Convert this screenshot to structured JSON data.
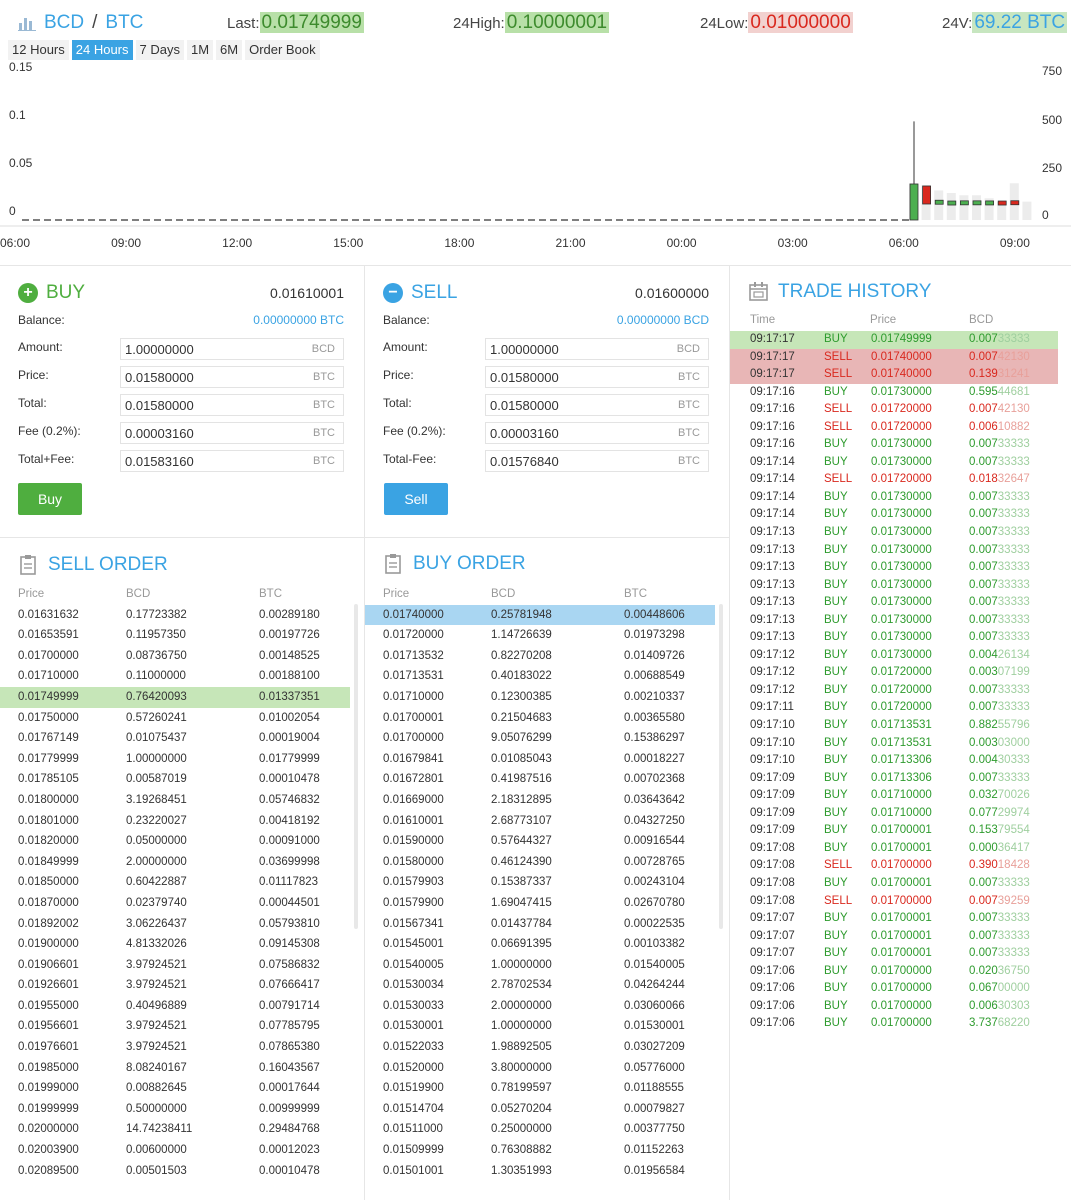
{
  "header": {
    "base": "BCD",
    "sep": "/",
    "quote": "BTC",
    "last_label": "Last:",
    "last_value": "0.01749999",
    "high_label": "24High:",
    "high_value": "0.10000001",
    "low_label": "24Low:",
    "low_value": "0.01000000",
    "vol_label": "24V:",
    "vol_value": "69.22 BTC"
  },
  "tabs": [
    {
      "label": "12 Hours",
      "active": false
    },
    {
      "label": "24 Hours",
      "active": true
    },
    {
      "label": "7 Days",
      "active": false
    },
    {
      "label": "1M",
      "active": false
    },
    {
      "label": "6M",
      "active": false
    },
    {
      "label": "Order Book",
      "active": false
    }
  ],
  "chart_data": {
    "type": "candlestick",
    "title": "",
    "y_left_ticks": [
      "0.15",
      "0.1",
      "0.05",
      "0"
    ],
    "y_left_range": [
      0,
      0.15
    ],
    "y_right_ticks": [
      "750",
      "500",
      "250",
      "0"
    ],
    "y_right_range": [
      0,
      750
    ],
    "x_ticks": [
      "06:00",
      "09:00",
      "12:00",
      "15:00",
      "18:00",
      "21:00",
      "00:00",
      "03:00",
      "06:00",
      "09:00"
    ],
    "candles": [
      {
        "open": 0.0175,
        "close": 0.0175,
        "high": 0.1,
        "low": 0.012,
        "bull": true
      },
      {
        "open": 0.0175,
        "close": 0.0175,
        "high": 0.0175,
        "low": 0.0175,
        "bull": true
      },
      {
        "open": 0.018,
        "close": 0.0175,
        "high": 0.018,
        "low": 0.0175,
        "bull": true
      },
      {
        "open": 0.0172,
        "close": 0.0172,
        "high": 0.0172,
        "low": 0.0172,
        "bull": true
      },
      {
        "open": 0.0174,
        "close": 0.0174,
        "high": 0.0174,
        "low": 0.0174,
        "bull": true
      },
      {
        "open": 0.0174,
        "close": 0.0174,
        "high": 0.0174,
        "low": 0.0174,
        "bull": true
      },
      {
        "open": 0.0173,
        "close": 0.0173,
        "high": 0.0173,
        "low": 0.0173,
        "bull": true
      },
      {
        "open": 0.0172,
        "close": 0.0172,
        "high": 0.0172,
        "low": 0.0172,
        "bull": false
      },
      {
        "open": 0.0175,
        "close": 0.0174,
        "high": 0.0176,
        "low": 0.0173,
        "bull": false
      }
    ],
    "volumes": [
      490,
      465,
      395,
      360,
      330,
      330,
      290,
      240,
      490,
      245
    ]
  },
  "buy_panel": {
    "title": "BUY",
    "price_top": "0.01610001",
    "balance_label": "Balance:",
    "balance_value": "0.00000000 BTC",
    "amount_label": "Amount:",
    "amount_value": "1.00000000",
    "amount_unit": "BCD",
    "price_label": "Price:",
    "price_value": "0.01580000",
    "price_unit": "BTC",
    "total_label": "Total:",
    "total_value": "0.01580000",
    "total_unit": "BTC",
    "fee_label": "Fee (0.2%):",
    "fee_value": "0.00003160",
    "fee_unit": "BTC",
    "tf_label": "Total+Fee:",
    "tf_value": "0.01583160",
    "tf_unit": "BTC",
    "button": "Buy"
  },
  "sell_panel": {
    "title": "SELL",
    "price_top": "0.01600000",
    "balance_label": "Balance:",
    "balance_value": "0.00000000 BCD",
    "amount_label": "Amount:",
    "amount_value": "1.00000000",
    "amount_unit": "BCD",
    "price_label": "Price:",
    "price_value": "0.01580000",
    "price_unit": "BTC",
    "total_label": "Total:",
    "total_value": "0.01580000",
    "total_unit": "BTC",
    "fee_label": "Fee (0.2%):",
    "fee_value": "0.00003160",
    "fee_unit": "BTC",
    "tf_label": "Total-Fee:",
    "tf_value": "0.01576840",
    "tf_unit": "BTC",
    "button": "Sell"
  },
  "sell_order": {
    "title": "SELL ORDER",
    "headers": [
      "Price",
      "BCD",
      "BTC"
    ],
    "highlight_index": 4,
    "rows": [
      [
        "0.01631632",
        "0.17723382",
        "0.00289180"
      ],
      [
        "0.01653591",
        "0.11957350",
        "0.00197726"
      ],
      [
        "0.01700000",
        "0.08736750",
        "0.00148525"
      ],
      [
        "0.01710000",
        "0.11000000",
        "0.00188100"
      ],
      [
        "0.01749999",
        "0.76420093",
        "0.01337351"
      ],
      [
        "0.01750000",
        "0.57260241",
        "0.01002054"
      ],
      [
        "0.01767149",
        "0.01075437",
        "0.00019004"
      ],
      [
        "0.01779999",
        "1.00000000",
        "0.01779999"
      ],
      [
        "0.01785105",
        "0.00587019",
        "0.00010478"
      ],
      [
        "0.01800000",
        "3.19268451",
        "0.05746832"
      ],
      [
        "0.01801000",
        "0.23220027",
        "0.00418192"
      ],
      [
        "0.01820000",
        "0.05000000",
        "0.00091000"
      ],
      [
        "0.01849999",
        "2.00000000",
        "0.03699998"
      ],
      [
        "0.01850000",
        "0.60422887",
        "0.01117823"
      ],
      [
        "0.01870000",
        "0.02379740",
        "0.00044501"
      ],
      [
        "0.01892002",
        "3.06226437",
        "0.05793810"
      ],
      [
        "0.01900000",
        "4.81332026",
        "0.09145308"
      ],
      [
        "0.01906601",
        "3.97924521",
        "0.07586832"
      ],
      [
        "0.01926601",
        "3.97924521",
        "0.07666417"
      ],
      [
        "0.01955000",
        "0.40496889",
        "0.00791714"
      ],
      [
        "0.01956601",
        "3.97924521",
        "0.07785795"
      ],
      [
        "0.01976601",
        "3.97924521",
        "0.07865380"
      ],
      [
        "0.01985000",
        "8.08240167",
        "0.16043567"
      ],
      [
        "0.01999000",
        "0.00882645",
        "0.00017644"
      ],
      [
        "0.01999999",
        "0.50000000",
        "0.00999999"
      ],
      [
        "0.02000000",
        "14.74238411",
        "0.29484768"
      ],
      [
        "0.02003900",
        "0.00600000",
        "0.00012023"
      ],
      [
        "0.02089500",
        "0.00501503",
        "0.00010478"
      ]
    ]
  },
  "buy_order": {
    "title": "BUY ORDER",
    "headers": [
      "Price",
      "BCD",
      "BTC"
    ],
    "highlight_index": 0,
    "rows": [
      [
        "0.01740000",
        "0.25781948",
        "0.00448606"
      ],
      [
        "0.01720000",
        "1.14726639",
        "0.01973298"
      ],
      [
        "0.01713532",
        "0.82270208",
        "0.01409726"
      ],
      [
        "0.01713531",
        "0.40183022",
        "0.00688549"
      ],
      [
        "0.01710000",
        "0.12300385",
        "0.00210337"
      ],
      [
        "0.01700001",
        "0.21504683",
        "0.00365580"
      ],
      [
        "0.01700000",
        "9.05076299",
        "0.15386297"
      ],
      [
        "0.01679841",
        "0.01085043",
        "0.00018227"
      ],
      [
        "0.01672801",
        "0.41987516",
        "0.00702368"
      ],
      [
        "0.01669000",
        "2.18312895",
        "0.03643642"
      ],
      [
        "0.01610001",
        "2.68773107",
        "0.04327250"
      ],
      [
        "0.01590000",
        "0.57644327",
        "0.00916544"
      ],
      [
        "0.01580000",
        "0.46124390",
        "0.00728765"
      ],
      [
        "0.01579903",
        "0.15387337",
        "0.00243104"
      ],
      [
        "0.01579900",
        "1.69047415",
        "0.02670780"
      ],
      [
        "0.01567341",
        "0.01437784",
        "0.00022535"
      ],
      [
        "0.01545001",
        "0.06691395",
        "0.00103382"
      ],
      [
        "0.01540005",
        "1.00000000",
        "0.01540005"
      ],
      [
        "0.01530034",
        "2.78702534",
        "0.04264244"
      ],
      [
        "0.01530033",
        "2.00000000",
        "0.03060066"
      ],
      [
        "0.01530001",
        "1.00000000",
        "0.01530001"
      ],
      [
        "0.01522033",
        "1.98892505",
        "0.03027209"
      ],
      [
        "0.01520000",
        "3.80000000",
        "0.05776000"
      ],
      [
        "0.01519900",
        "0.78199597",
        "0.01188555"
      ],
      [
        "0.01514704",
        "0.05270204",
        "0.00079827"
      ],
      [
        "0.01511000",
        "0.25000000",
        "0.00377750"
      ],
      [
        "0.01509999",
        "0.76308882",
        "0.01152263"
      ],
      [
        "0.01501001",
        "1.30351993",
        "0.01956584"
      ]
    ]
  },
  "trade_history": {
    "title": "TRADE HISTORY",
    "headers": [
      "Time",
      "Price",
      "BCD"
    ],
    "rows": [
      {
        "time": "09:17:17",
        "side": "BUY",
        "price": "0.01749999",
        "amt_a": "0.007",
        "amt_b": "33333",
        "hl": "green"
      },
      {
        "time": "09:17:17",
        "side": "SELL",
        "price": "0.01740000",
        "amt_a": "0.007",
        "amt_b": "42130",
        "hl": "red"
      },
      {
        "time": "09:17:17",
        "side": "SELL",
        "price": "0.01740000",
        "amt_a": "0.139",
        "amt_b": "31241",
        "hl": "red"
      },
      {
        "time": "09:17:16",
        "side": "BUY",
        "price": "0.01730000",
        "amt_a": "0.595",
        "amt_b": "44681",
        "hl": ""
      },
      {
        "time": "09:17:16",
        "side": "SELL",
        "price": "0.01720000",
        "amt_a": "0.007",
        "amt_b": "42130",
        "hl": ""
      },
      {
        "time": "09:17:16",
        "side": "SELL",
        "price": "0.01720000",
        "amt_a": "0.006",
        "amt_b": "10882",
        "hl": ""
      },
      {
        "time": "09:17:16",
        "side": "BUY",
        "price": "0.01730000",
        "amt_a": "0.007",
        "amt_b": "33333",
        "hl": ""
      },
      {
        "time": "09:17:14",
        "side": "BUY",
        "price": "0.01730000",
        "amt_a": "0.007",
        "amt_b": "33333",
        "hl": ""
      },
      {
        "time": "09:17:14",
        "side": "SELL",
        "price": "0.01720000",
        "amt_a": "0.018",
        "amt_b": "32647",
        "hl": ""
      },
      {
        "time": "09:17:14",
        "side": "BUY",
        "price": "0.01730000",
        "amt_a": "0.007",
        "amt_b": "33333",
        "hl": ""
      },
      {
        "time": "09:17:14",
        "side": "BUY",
        "price": "0.01730000",
        "amt_a": "0.007",
        "amt_b": "33333",
        "hl": ""
      },
      {
        "time": "09:17:13",
        "side": "BUY",
        "price": "0.01730000",
        "amt_a": "0.007",
        "amt_b": "33333",
        "hl": ""
      },
      {
        "time": "09:17:13",
        "side": "BUY",
        "price": "0.01730000",
        "amt_a": "0.007",
        "amt_b": "33333",
        "hl": ""
      },
      {
        "time": "09:17:13",
        "side": "BUY",
        "price": "0.01730000",
        "amt_a": "0.007",
        "amt_b": "33333",
        "hl": ""
      },
      {
        "time": "09:17:13",
        "side": "BUY",
        "price": "0.01730000",
        "amt_a": "0.007",
        "amt_b": "33333",
        "hl": ""
      },
      {
        "time": "09:17:13",
        "side": "BUY",
        "price": "0.01730000",
        "amt_a": "0.007",
        "amt_b": "33333",
        "hl": ""
      },
      {
        "time": "09:17:13",
        "side": "BUY",
        "price": "0.01730000",
        "amt_a": "0.007",
        "amt_b": "33333",
        "hl": ""
      },
      {
        "time": "09:17:13",
        "side": "BUY",
        "price": "0.01730000",
        "amt_a": "0.007",
        "amt_b": "33333",
        "hl": ""
      },
      {
        "time": "09:17:12",
        "side": "BUY",
        "price": "0.01730000",
        "amt_a": "0.004",
        "amt_b": "26134",
        "hl": ""
      },
      {
        "time": "09:17:12",
        "side": "BUY",
        "price": "0.01720000",
        "amt_a": "0.003",
        "amt_b": "07199",
        "hl": ""
      },
      {
        "time": "09:17:12",
        "side": "BUY",
        "price": "0.01720000",
        "amt_a": "0.007",
        "amt_b": "33333",
        "hl": ""
      },
      {
        "time": "09:17:11",
        "side": "BUY",
        "price": "0.01720000",
        "amt_a": "0.007",
        "amt_b": "33333",
        "hl": ""
      },
      {
        "time": "09:17:10",
        "side": "BUY",
        "price": "0.01713531",
        "amt_a": "0.882",
        "amt_b": "55796",
        "hl": ""
      },
      {
        "time": "09:17:10",
        "side": "BUY",
        "price": "0.01713531",
        "amt_a": "0.003",
        "amt_b": "03000",
        "hl": ""
      },
      {
        "time": "09:17:10",
        "side": "BUY",
        "price": "0.01713306",
        "amt_a": "0.004",
        "amt_b": "30333",
        "hl": ""
      },
      {
        "time": "09:17:09",
        "side": "BUY",
        "price": "0.01713306",
        "amt_a": "0.007",
        "amt_b": "33333",
        "hl": ""
      },
      {
        "time": "09:17:09",
        "side": "BUY",
        "price": "0.01710000",
        "amt_a": "0.032",
        "amt_b": "70026",
        "hl": ""
      },
      {
        "time": "09:17:09",
        "side": "BUY",
        "price": "0.01710000",
        "amt_a": "0.077",
        "amt_b": "29974",
        "hl": ""
      },
      {
        "time": "09:17:09",
        "side": "BUY",
        "price": "0.01700001",
        "amt_a": "0.153",
        "amt_b": "79554",
        "hl": ""
      },
      {
        "time": "09:17:08",
        "side": "BUY",
        "price": "0.01700001",
        "amt_a": "0.000",
        "amt_b": "36417",
        "hl": ""
      },
      {
        "time": "09:17:08",
        "side": "SELL",
        "price": "0.01700000",
        "amt_a": "0.390",
        "amt_b": "18428",
        "hl": ""
      },
      {
        "time": "09:17:08",
        "side": "BUY",
        "price": "0.01700001",
        "amt_a": "0.007",
        "amt_b": "33333",
        "hl": ""
      },
      {
        "time": "09:17:08",
        "side": "SELL",
        "price": "0.01700000",
        "amt_a": "0.007",
        "amt_b": "39259",
        "hl": ""
      },
      {
        "time": "09:17:07",
        "side": "BUY",
        "price": "0.01700001",
        "amt_a": "0.007",
        "amt_b": "33333",
        "hl": ""
      },
      {
        "time": "09:17:07",
        "side": "BUY",
        "price": "0.01700001",
        "amt_a": "0.007",
        "amt_b": "33333",
        "hl": ""
      },
      {
        "time": "09:17:07",
        "side": "BUY",
        "price": "0.01700001",
        "amt_a": "0.007",
        "amt_b": "33333",
        "hl": ""
      },
      {
        "time": "09:17:06",
        "side": "BUY",
        "price": "0.01700000",
        "amt_a": "0.020",
        "amt_b": "36750",
        "hl": ""
      },
      {
        "time": "09:17:06",
        "side": "BUY",
        "price": "0.01700000",
        "amt_a": "0.067",
        "amt_b": "00000",
        "hl": ""
      },
      {
        "time": "09:17:06",
        "side": "BUY",
        "price": "0.01700000",
        "amt_a": "0.006",
        "amt_b": "30303",
        "hl": ""
      },
      {
        "time": "09:17:06",
        "side": "BUY",
        "price": "0.01700000",
        "amt_a": "3.737",
        "amt_b": "68220",
        "hl": ""
      }
    ]
  },
  "colors": {
    "accent": "#3aa3e3",
    "buy": "#2e9b2e",
    "sell": "#d9281e",
    "green_hl": "#c6e6b8",
    "red_hl": "#e8b6b6",
    "blue_hl": "#a9d6f2",
    "buy_button": "#4fae3f",
    "sell_button": "#3aa3e3"
  }
}
